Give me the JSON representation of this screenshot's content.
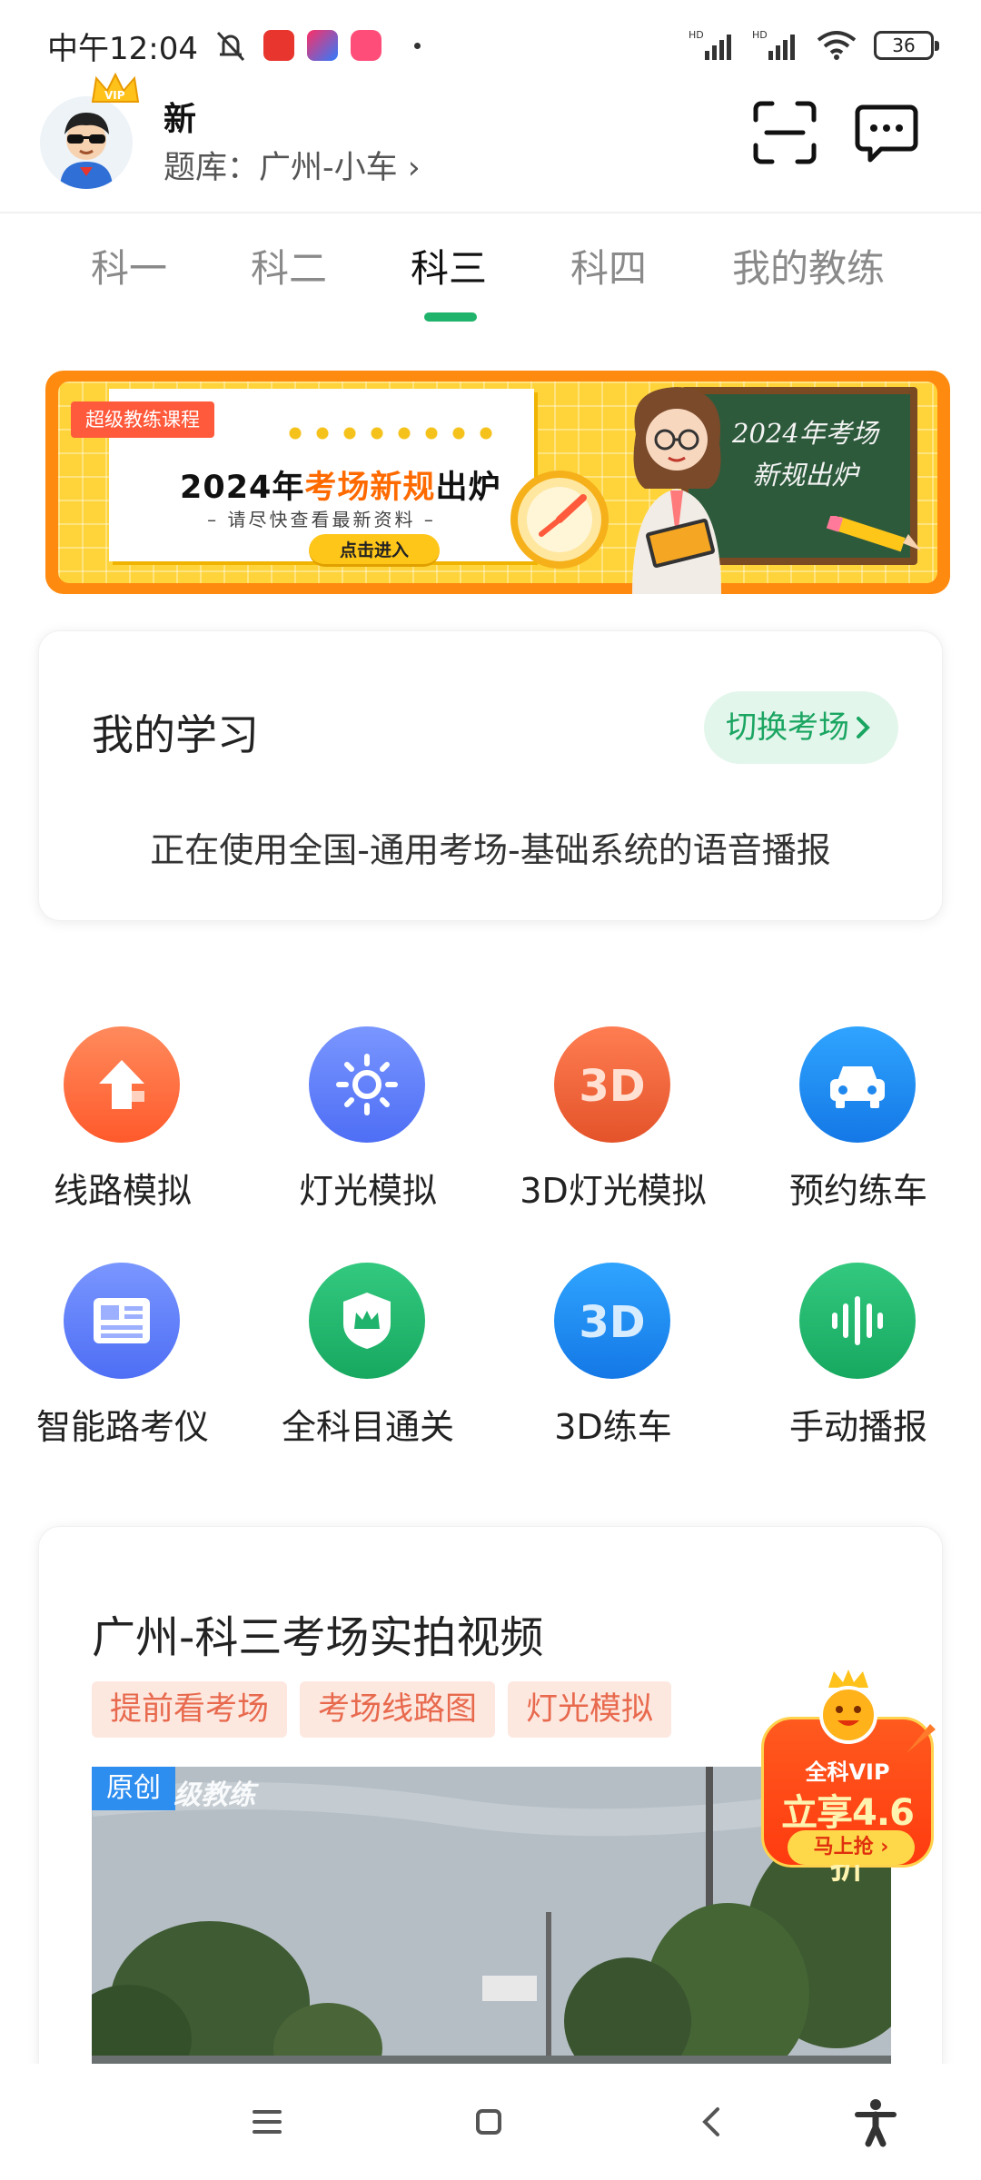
{
  "status_bar": {
    "time": "中午12:04",
    "battery": "36"
  },
  "header": {
    "user_name": "新",
    "question_bank": "题库：广州-小车 ›"
  },
  "tabs": [
    {
      "label": "科一"
    },
    {
      "label": "科二"
    },
    {
      "label": "科三",
      "active": true
    },
    {
      "label": "科四"
    },
    {
      "label": "我的教练"
    }
  ],
  "banner": {
    "tag": "超级教练课程",
    "title_pre": "2024年",
    "title_highlight": "考场新规",
    "title_post": "出炉",
    "subtitle": "– 请尽快查看最新资料 –",
    "button": "点击进入",
    "board_line1": "2024年考场",
    "board_line2": "新规出炉"
  },
  "study": {
    "title": "我的学习",
    "switch_label": "切换考场",
    "description": "正在使用全国-通用考场-基础系统的语音播报"
  },
  "features": [
    {
      "label": "线路模拟",
      "icon": "arrow-up-icon",
      "color": "#ff6b3d"
    },
    {
      "label": "灯光模拟",
      "icon": "sun-icon",
      "color": "#5b7cf7"
    },
    {
      "label": "3D灯光模拟",
      "icon": "3d-icon",
      "color": "#f2673c"
    },
    {
      "label": "预约练车",
      "icon": "car-icon",
      "color": "#1e90f0"
    },
    {
      "label": "智能路考仪",
      "icon": "newspaper-icon",
      "color": "#5b7cf7"
    },
    {
      "label": "全科目通关",
      "icon": "crown-shield-icon",
      "color": "#1fb36b"
    },
    {
      "label": "3D练车",
      "icon": "3d-icon",
      "color": "#1e90f0"
    },
    {
      "label": "手动播报",
      "icon": "sound-wave-icon",
      "color": "#1fb36b"
    }
  ],
  "video_section": {
    "title": "广州-科三考场实拍视频",
    "chips": [
      "提前看考场",
      "考场线路图",
      "灯光模拟"
    ],
    "badge": "原创",
    "watermark": "级教练"
  },
  "vip_promo": {
    "line1": "全科VIP",
    "line2": "立享4.6折",
    "button": "马上抢 ›"
  }
}
